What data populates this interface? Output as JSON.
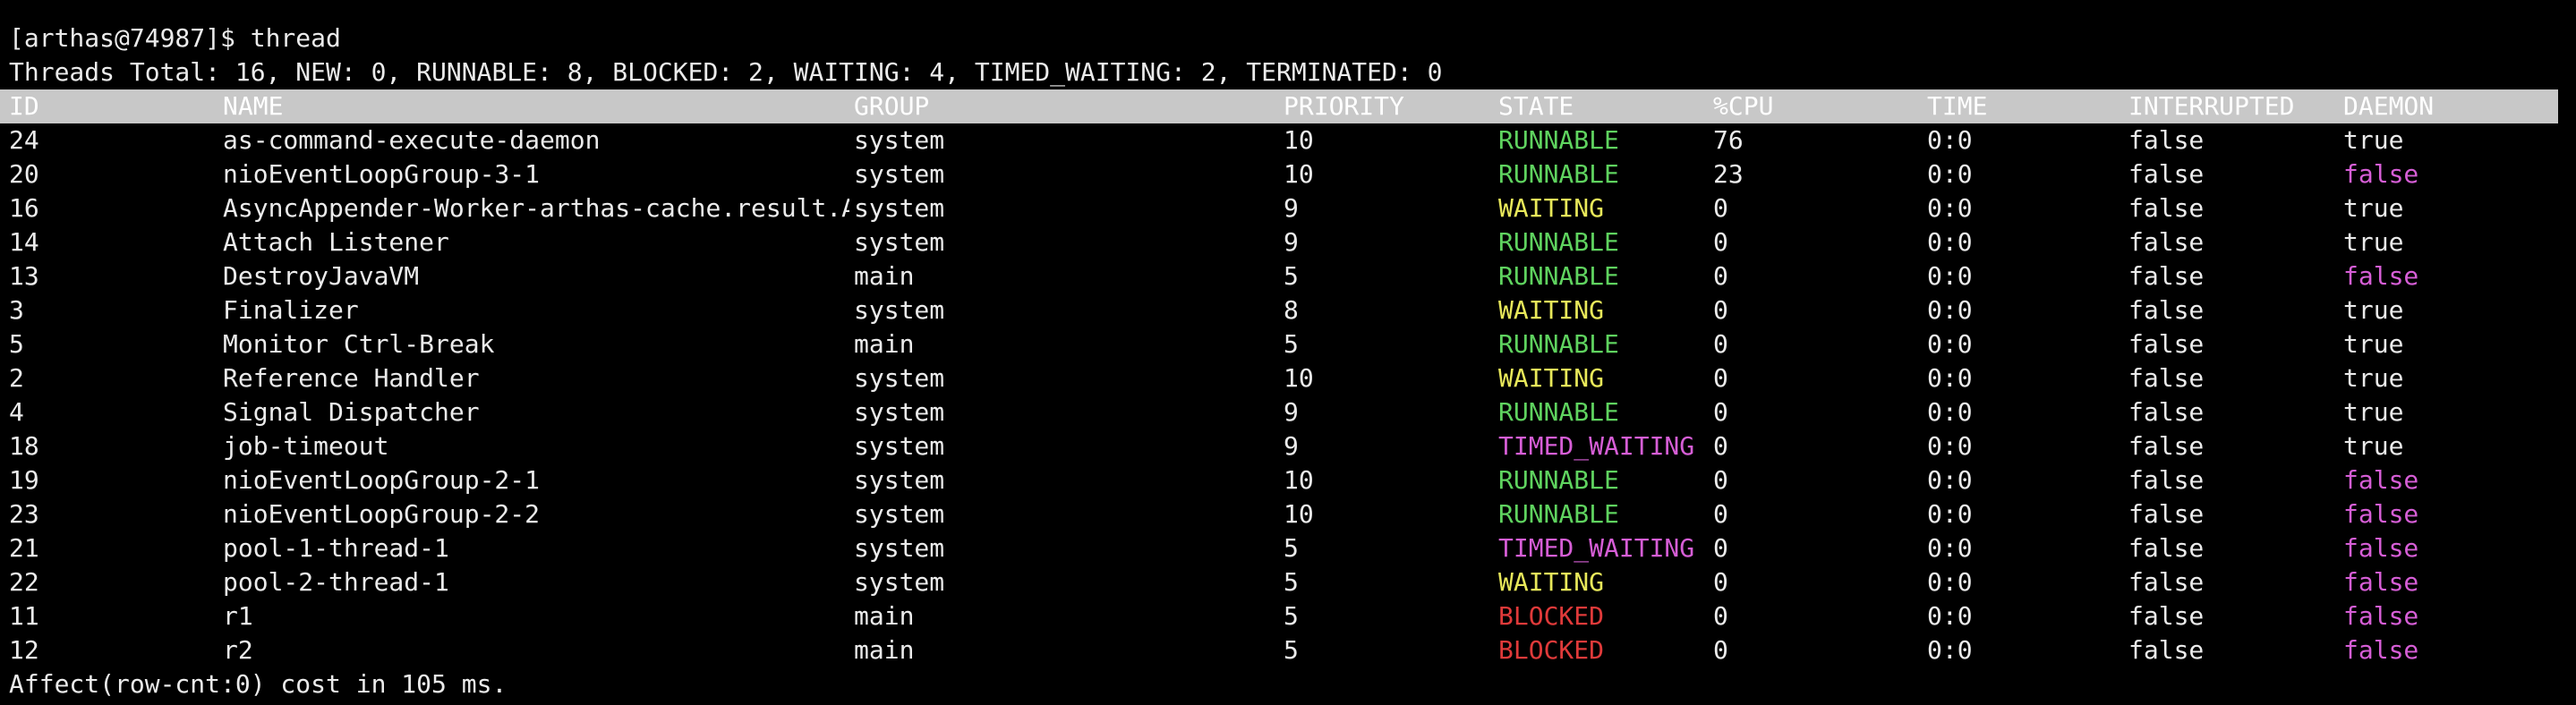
{
  "colors": {
    "background": "#000000",
    "text": "#ebebeb",
    "header_bg": "#c8c8c8",
    "runnable": "#5fd35f",
    "waiting": "#e8e85a",
    "timed_waiting": "#d65ed6",
    "blocked": "#e03a3a",
    "daemon_false": "#d65ed6"
  },
  "prompt": {
    "text": "[arthas@74987]$ thread"
  },
  "summary": {
    "text": "Threads Total: 16, NEW: 0, RUNNABLE: 8, BLOCKED: 2, WAITING: 4, TIMED_WAITING: 2, TERMINATED: 0"
  },
  "table": {
    "headers": [
      "ID",
      "NAME",
      "GROUP",
      "PRIORITY",
      "STATE",
      "%CPU",
      "TIME",
      "INTERRUPTED",
      "DAEMON"
    ],
    "rows": [
      [
        "24",
        "as-command-execute-daemon",
        "system",
        "10",
        "RUNNABLE",
        "76",
        "0:0",
        "false",
        "true"
      ],
      [
        "20",
        "nioEventLoopGroup-3-1",
        "system",
        "10",
        "RUNNABLE",
        "23",
        "0:0",
        "false",
        "false"
      ],
      [
        "16",
        "AsyncAppender-Worker-arthas-cache.result.As",
        "system",
        "9",
        "WAITING",
        "0",
        "0:0",
        "false",
        "true"
      ],
      [
        "14",
        "Attach Listener",
        "system",
        "9",
        "RUNNABLE",
        "0",
        "0:0",
        "false",
        "true"
      ],
      [
        "13",
        "DestroyJavaVM",
        "main",
        "5",
        "RUNNABLE",
        "0",
        "0:0",
        "false",
        "false"
      ],
      [
        "3",
        "Finalizer",
        "system",
        "8",
        "WAITING",
        "0",
        "0:0",
        "false",
        "true"
      ],
      [
        "5",
        "Monitor Ctrl-Break",
        "main",
        "5",
        "RUNNABLE",
        "0",
        "0:0",
        "false",
        "true"
      ],
      [
        "2",
        "Reference Handler",
        "system",
        "10",
        "WAITING",
        "0",
        "0:0",
        "false",
        "true"
      ],
      [
        "4",
        "Signal Dispatcher",
        "system",
        "9",
        "RUNNABLE",
        "0",
        "0:0",
        "false",
        "true"
      ],
      [
        "18",
        "job-timeout",
        "system",
        "9",
        "TIMED_WAITING",
        "0",
        "0:0",
        "false",
        "true"
      ],
      [
        "19",
        "nioEventLoopGroup-2-1",
        "system",
        "10",
        "RUNNABLE",
        "0",
        "0:0",
        "false",
        "false"
      ],
      [
        "23",
        "nioEventLoopGroup-2-2",
        "system",
        "10",
        "RUNNABLE",
        "0",
        "0:0",
        "false",
        "false"
      ],
      [
        "21",
        "pool-1-thread-1",
        "system",
        "5",
        "TIMED_WAITING",
        "0",
        "0:0",
        "false",
        "false"
      ],
      [
        "22",
        "pool-2-thread-1",
        "system",
        "5",
        "WAITING",
        "0",
        "0:0",
        "false",
        "false"
      ],
      [
        "11",
        "r1",
        "main",
        "5",
        "BLOCKED",
        "0",
        "0:0",
        "false",
        "false"
      ],
      [
        "12",
        "r2",
        "main",
        "5",
        "BLOCKED",
        "0",
        "0:0",
        "false",
        "false"
      ]
    ]
  },
  "footer": {
    "text": "Affect(row-cnt:0) cost in 105 ms."
  }
}
